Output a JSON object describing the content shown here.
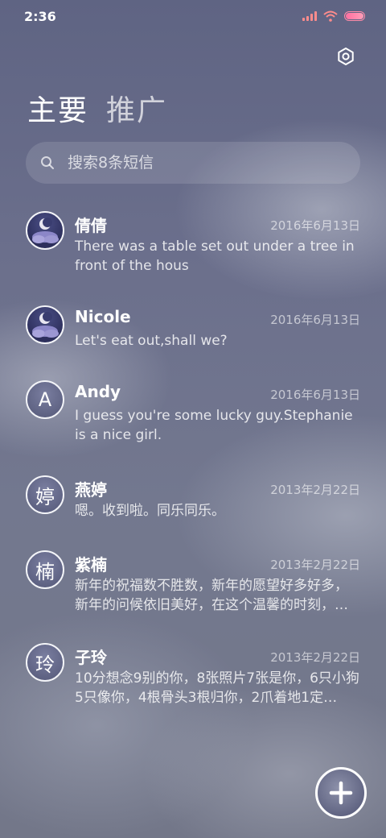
{
  "status_bar": {
    "time": "2:36"
  },
  "header": {
    "tabs": [
      {
        "label": "主要",
        "active": true
      },
      {
        "label": "推广",
        "active": false
      }
    ]
  },
  "search": {
    "placeholder": "搜索8条短信"
  },
  "conversations": [
    {
      "name": "倩倩",
      "date": "2016年6月13日",
      "snippet": "There was a table set out under a tree in front of the hous",
      "avatar_type": "image",
      "avatar_icon": "moon-night-icon"
    },
    {
      "name": "Nicole",
      "date": "2016年6月13日",
      "snippet": "Let's eat out,shall we?",
      "avatar_type": "image",
      "avatar_icon": "moon-night-icon"
    },
    {
      "name": "Andy",
      "date": "2016年6月13日",
      "snippet": "I guess you're some lucky guy.Stephanie is a nice girl.",
      "avatar_type": "letter",
      "avatar_letter": "A"
    },
    {
      "name": "燕婷",
      "date": "2013年2月22日",
      "snippet": "嗯。收到啦。同乐同乐。",
      "avatar_type": "letter",
      "avatar_letter": "婷"
    },
    {
      "name": "紫楠",
      "date": "2013年2月22日",
      "snippet": "新年的祝福数不胜数，新年的愿望好多好多，新年的问候依旧美好，在这个温馨的时刻，…",
      "avatar_type": "letter",
      "avatar_letter": "楠"
    },
    {
      "name": "子玲",
      "date": "2013年2月22日",
      "snippet": "10分想念9别的你，8张照片7张是你，6只小狗5只像你，4根骨头3根归你，2爪着地1定…",
      "avatar_type": "letter",
      "avatar_letter": "玲"
    }
  ],
  "colors": {
    "battery": "#ff8aa8",
    "signal": "#ff8c8c",
    "wifi": "#ff8c8c"
  }
}
